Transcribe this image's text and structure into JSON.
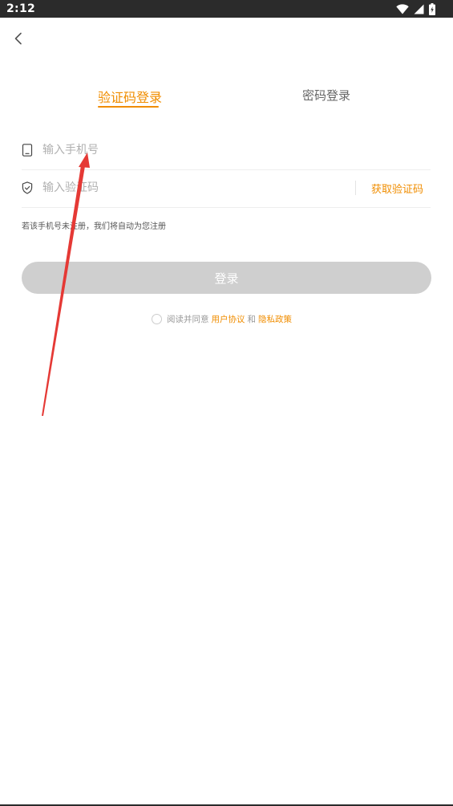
{
  "status_bar": {
    "time": "2:12"
  },
  "tabs": [
    {
      "label": "验证码登录",
      "active": true
    },
    {
      "label": "密码登录",
      "active": false
    }
  ],
  "form": {
    "phone_placeholder": "输入手机号",
    "phone_value": "",
    "code_placeholder": "输入验证码",
    "code_value": "",
    "get_code_label": "获取验证码"
  },
  "hint": "若该手机号未注册，我们将自动为您注册",
  "login_button": "登录",
  "agreement": {
    "checked": false,
    "prefix": "阅读并同意",
    "user_agreement": "用户协议",
    "and": "和",
    "privacy_policy": "隐私政策"
  },
  "colors": {
    "accent": "#f08d00",
    "login_disabled": "#cfcfcf",
    "status_bar": "#2b2b2b",
    "annotation": "#e53935"
  },
  "icons": {
    "back": "chevron-left-icon",
    "phone": "phone-icon",
    "shield": "shield-check-icon",
    "wifi": "wifi-icon",
    "signal": "signal-icon",
    "battery": "battery-icon"
  }
}
